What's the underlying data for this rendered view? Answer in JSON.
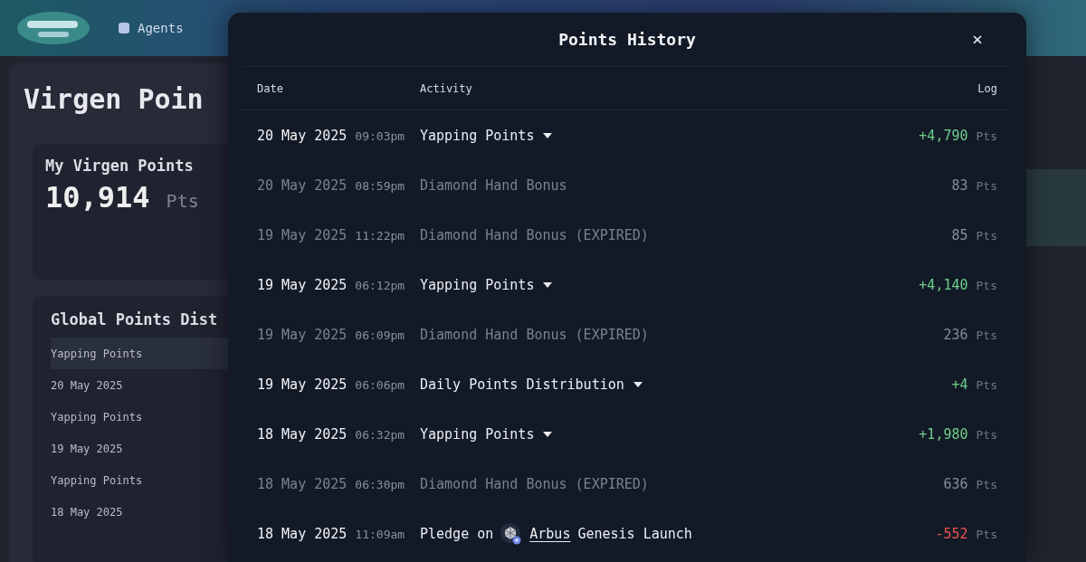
{
  "background_page": {
    "nav_item": "Agents",
    "title": "Virgen Poin",
    "card_title": "My Virgen Points",
    "points": "10,914",
    "points_unit": "Pts",
    "section_title": "Global Points Dist",
    "list": [
      "Yapping Points",
      "20 May 2025",
      "Yapping Points",
      "19 May 2025",
      "Yapping Points",
      "18 May 2025"
    ]
  },
  "modal": {
    "title": "Points History",
    "close": "×",
    "columns": [
      "Date",
      "Activity",
      "Log"
    ],
    "rows": [
      {
        "date": "20 May 2025",
        "time": "09:03pm",
        "activity": "Yapping Points",
        "dimmed": false,
        "expandable": true,
        "amount": "+4,790",
        "unit": "Pts",
        "kind": "gain"
      },
      {
        "date": "20 May 2025",
        "time": "08:59pm",
        "activity": "Diamond Hand Bonus",
        "dimmed": true,
        "expandable": false,
        "amount": "83",
        "unit": "Pts",
        "kind": "plain"
      },
      {
        "date": "19 May 2025",
        "time": "11:22pm",
        "activity": "Diamond Hand Bonus (EXPIRED)",
        "dimmed": true,
        "expandable": false,
        "amount": "85",
        "unit": "Pts",
        "kind": "plain"
      },
      {
        "date": "19 May 2025",
        "time": "06:12pm",
        "activity": "Yapping Points",
        "dimmed": false,
        "expandable": true,
        "amount": "+4,140",
        "unit": "Pts",
        "kind": "gain"
      },
      {
        "date": "19 May 2025",
        "time": "06:09pm",
        "activity": "Diamond Hand Bonus (EXPIRED)",
        "dimmed": true,
        "expandable": false,
        "amount": "236",
        "unit": "Pts",
        "kind": "plain"
      },
      {
        "date": "19 May 2025",
        "time": "06:06pm",
        "activity": "Daily Points Distribution",
        "dimmed": false,
        "expandable": true,
        "amount": "+4",
        "unit": "Pts",
        "kind": "gain"
      },
      {
        "date": "18 May 2025",
        "time": "06:32pm",
        "activity": "Yapping Points",
        "dimmed": false,
        "expandable": true,
        "amount": "+1,980",
        "unit": "Pts",
        "kind": "gain"
      },
      {
        "date": "18 May 2025",
        "time": "06:30pm",
        "activity": "Diamond Hand Bonus (EXPIRED)",
        "dimmed": true,
        "expandable": false,
        "amount": "636",
        "unit": "Pts",
        "kind": "plain"
      },
      {
        "date": "18 May 2025",
        "time": "11:09am",
        "activity": "Pledge on",
        "link": "Arbus",
        "activity_suffix": "Genesis Launch",
        "dimmed": false,
        "expandable": false,
        "amount": "-552",
        "unit": "Pts",
        "kind": "loss"
      }
    ]
  }
}
